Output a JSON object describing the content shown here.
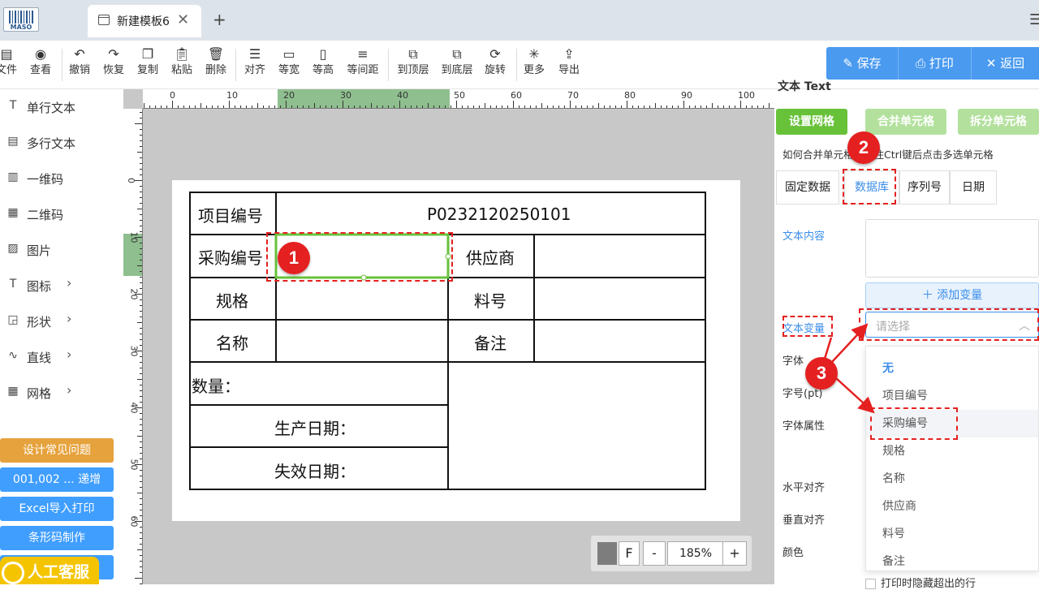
{
  "tabbar": {
    "logo_text": "MASO",
    "active_tab": "新建模板6",
    "close": "✕",
    "add": "+",
    "menu_glyph": "☰"
  },
  "toolbar": {
    "file": "文件",
    "view": "查看",
    "undo": "撤销",
    "redo": "恢复",
    "copy": "复制",
    "paste": "粘贴",
    "delete": "删除",
    "align": "对齐",
    "equal_width": "等宽",
    "equal_height": "等高",
    "equal_spacing": "等间距",
    "to_top": "到顶层",
    "to_bottom": "到底层",
    "rotate": "旋转",
    "more": "更多",
    "export": "导出"
  },
  "actions": {
    "save": "保存",
    "print": "打印",
    "back": "返回"
  },
  "left_panel": {
    "items": [
      {
        "label": "单行文本",
        "icon": "T"
      },
      {
        "label": "多行文本",
        "icon": "▤"
      },
      {
        "label": "一维码",
        "icon": "▥"
      },
      {
        "label": "二维码",
        "icon": "▦"
      },
      {
        "label": "图片",
        "icon": "▨"
      },
      {
        "label": "图标",
        "icon": "T"
      },
      {
        "label": "形状",
        "icon": "◲"
      },
      {
        "label": "直线",
        "icon": "∿"
      },
      {
        "label": "网格",
        "icon": "▦"
      }
    ],
    "arrow": "›",
    "buttons": {
      "faq": "设计常见问题",
      "increment": "001,002 ... 递增",
      "excel": "Excel导入打印",
      "barcode": "条形码制作"
    },
    "support": "人工客服",
    "colors": {
      "faq": "#e6a23c",
      "blue": "#409eff",
      "support": "#f5c400"
    }
  },
  "ruler": {
    "h_labels": [
      "0",
      "10",
      "20",
      "30",
      "40",
      "50",
      "60",
      "70",
      "80",
      "90",
      "100"
    ],
    "v_labels": [
      "0",
      "10",
      "20",
      "30",
      "40",
      "50",
      "60"
    ]
  },
  "template": {
    "project_no_label": "项目编号",
    "project_no_value": "P0232120250101",
    "purchase_no_label": "采购编号",
    "supplier_label": "供应商",
    "spec_label": "规格",
    "part_no_label": "料号",
    "name_label": "名称",
    "note_label": "备注",
    "quantity_label": "数量：",
    "production_date_label": "生产日期：",
    "expiry_date_label": "失效日期："
  },
  "zoom": {
    "f": "F",
    "minus": "-",
    "value": "185%",
    "plus": "+"
  },
  "right_panel": {
    "header_fragment": "文本 Text",
    "grid_buttons": {
      "set_grid": "设置网格",
      "merge": "合并单元格",
      "split": "拆分单元格"
    },
    "hint": "如何合并单元格：按住Ctrl键后点击多选单元格",
    "tabs": [
      "固定数据",
      "数据库",
      "序列号",
      "日期"
    ],
    "active_tab": "数据库",
    "labels": {
      "text_content": "文本内容",
      "text_variable": "文本变量",
      "font": "字体",
      "font_size": "字号(pt)",
      "font_attr": "字体属性",
      "h_align": "水平对齐",
      "v_align": "垂直对齐",
      "color": "颜色"
    },
    "add_variable": "＋ 添加变量",
    "select_placeholder": "请选择",
    "dropdown_options": [
      "无",
      "项目编号",
      "采购编号",
      "规格",
      "名称",
      "供应商",
      "料号",
      "备注"
    ],
    "hide_overflow": "打印时隐藏超出的行",
    "colors": {
      "green": "#67c23a",
      "green_light": "#b3e19d",
      "blue": "#3b8ee8"
    }
  },
  "annotations": {
    "one": "1",
    "two": "2",
    "three": "3"
  }
}
